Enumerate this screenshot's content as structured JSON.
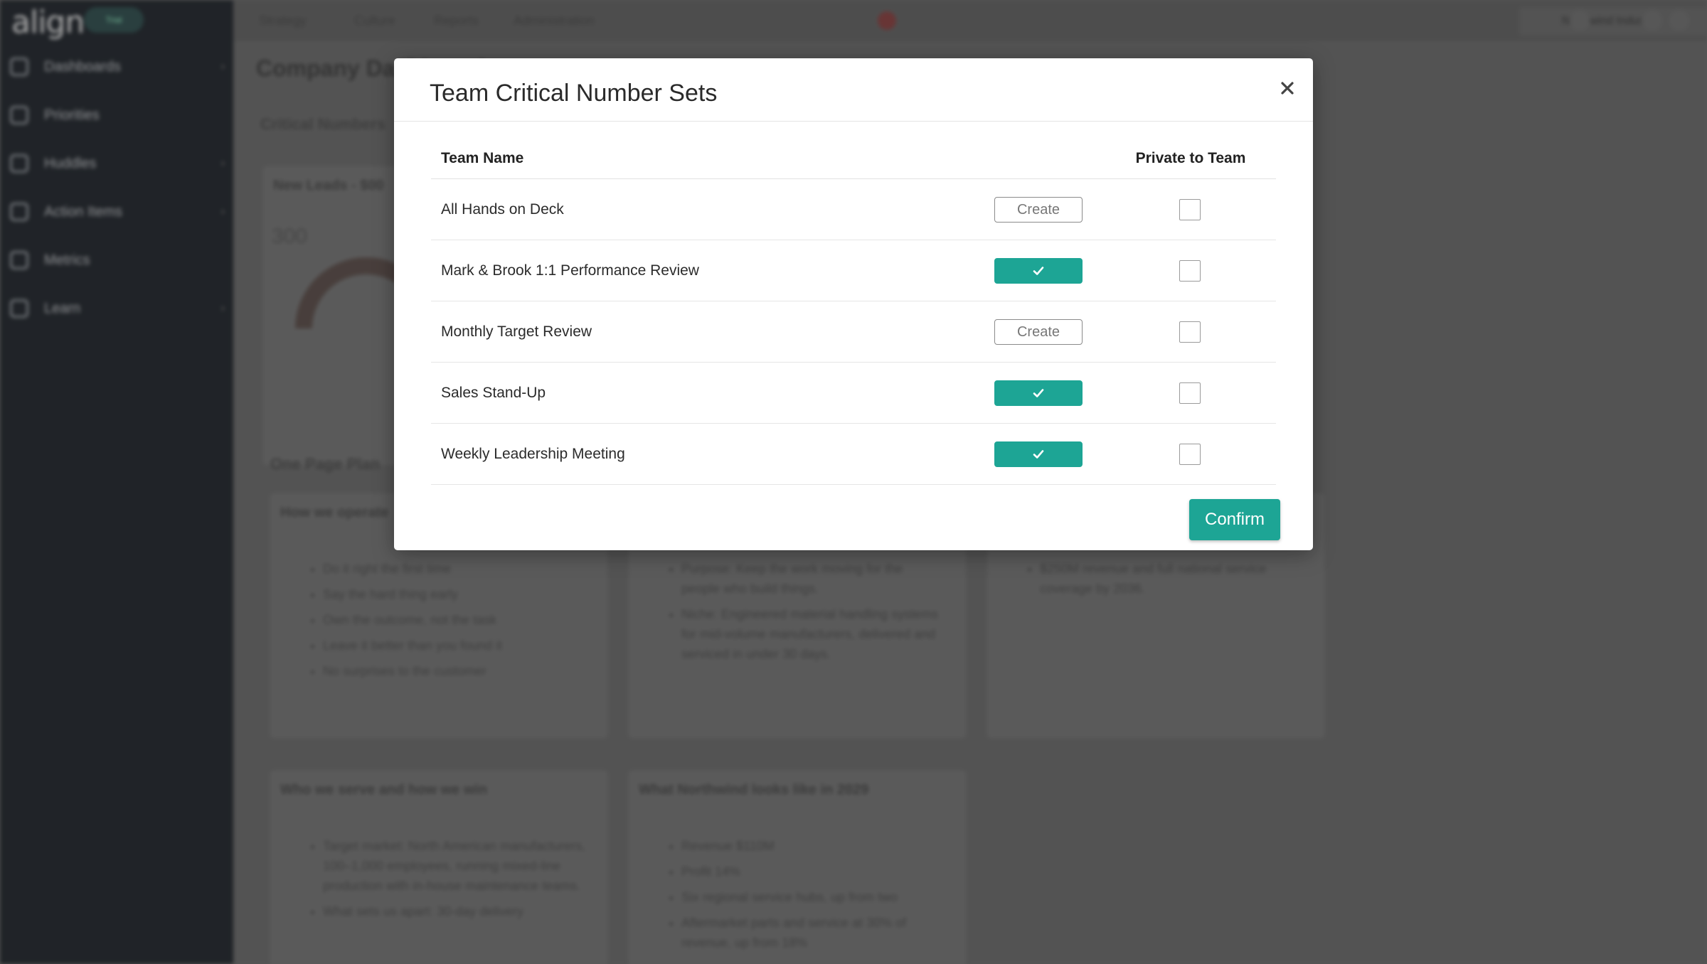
{
  "background": {
    "logo": "align",
    "trial_badge": "Trial",
    "sidebar": {
      "items": [
        {
          "label": "Dashboards",
          "icon": "home-icon"
        },
        {
          "label": "Priorities",
          "icon": "trend-icon"
        },
        {
          "label": "Huddles",
          "icon": "people-icon"
        },
        {
          "label": "Action Items",
          "icon": "checklist-icon"
        },
        {
          "label": "Metrics",
          "icon": "gauge-icon"
        },
        {
          "label": "Learn",
          "icon": "graduation-cap-icon"
        }
      ]
    },
    "topnav": {
      "strategy": "Strategy",
      "culture": "Culture",
      "reports": "Reports",
      "administration": "Administration"
    },
    "company": {
      "code": "NW",
      "name": "Northwind Industrial"
    },
    "page_title": "Company Dashboard",
    "critical_numbers_title": "Critical Numbers",
    "metric_card": {
      "title": "New Leads - $00",
      "value": "300"
    },
    "opp_title": "One Page Plan",
    "cards": [
      {
        "title": "How we operate",
        "items": [
          "Do it right the first time",
          "Say the hard thing early",
          "Own the outcome, not the task",
          "Leave it better than you found it",
          "No surprises to the customer"
        ]
      },
      {
        "title": "",
        "items": [
          "Purpose: Keep the work moving for the people who build things.",
          "Niche: Engineered material handling systems for mid-volume manufacturers, delivered and serviced in under 30 days."
        ]
      },
      {
        "title": "",
        "items": [
          "$250M revenue and full national service coverage by 2036."
        ]
      },
      {
        "title": "Who we serve and how we win",
        "items": [
          "Target market: North American manufacturers, 100–1,000 employees, running mixed-line production with in-house maintenance teams.",
          "What sets us apart: 30-day delivery"
        ]
      },
      {
        "title": "What Northwind looks like in 2029",
        "items": [
          "Revenue $110M",
          "Profit 14%",
          "Six regional service hubs, up from two",
          "Aftermarket parts and service at 30% of revenue, up from 18%"
        ]
      }
    ]
  },
  "modal": {
    "title": "Team Critical Number Sets",
    "headers": {
      "team_name": "Team Name",
      "private": "Private to Team"
    },
    "create_label": "Create",
    "rows": [
      {
        "team": "All Hands on Deck",
        "has_set": false,
        "private": false
      },
      {
        "team": "Mark & Brook 1:1 Performance Review",
        "has_set": true,
        "private": false
      },
      {
        "team": "Monthly Target Review",
        "has_set": false,
        "private": false
      },
      {
        "team": "Sales Stand-Up",
        "has_set": true,
        "private": false
      },
      {
        "team": "Weekly Leadership Meeting",
        "has_set": true,
        "private": false
      }
    ],
    "confirm_label": "Confirm",
    "accent_color": "#1da595"
  }
}
